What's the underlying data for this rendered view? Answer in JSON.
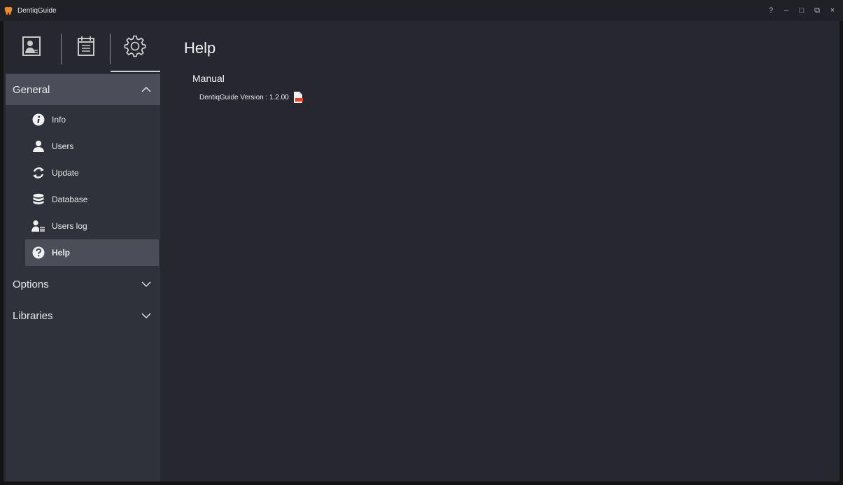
{
  "window": {
    "title": "DentiqGuide",
    "controls": [
      "?",
      "–",
      "□",
      "⧉",
      "×"
    ]
  },
  "sidebar": {
    "tabs": [
      {
        "name": "patient-tab",
        "icon": "patient-card-icon"
      },
      {
        "name": "calendar-tab",
        "icon": "calendar-icon"
      },
      {
        "name": "settings-tab",
        "icon": "gear-icon",
        "active": true
      }
    ],
    "sections": [
      {
        "label": "General",
        "expanded": true,
        "items": [
          {
            "label": "Info",
            "icon": "info-icon"
          },
          {
            "label": "Users",
            "icon": "user-icon"
          },
          {
            "label": "Update",
            "icon": "refresh-icon"
          },
          {
            "label": "Database",
            "icon": "database-icon"
          },
          {
            "label": "Users log",
            "icon": "users-log-icon"
          },
          {
            "label": "Help",
            "icon": "help-icon",
            "active": true
          }
        ]
      },
      {
        "label": "Options",
        "expanded": false
      },
      {
        "label": "Libraries",
        "expanded": false
      }
    ]
  },
  "main": {
    "title": "Help",
    "manual": {
      "heading": "Manual",
      "version_text": "DentiqGuide Version : 1.2.00"
    }
  },
  "colors": {
    "background": "#26272f",
    "sidebar": "#2f323a",
    "selected": "#4b4e58",
    "pdf_accent": "#e3452f",
    "logo": "#f08a24"
  }
}
